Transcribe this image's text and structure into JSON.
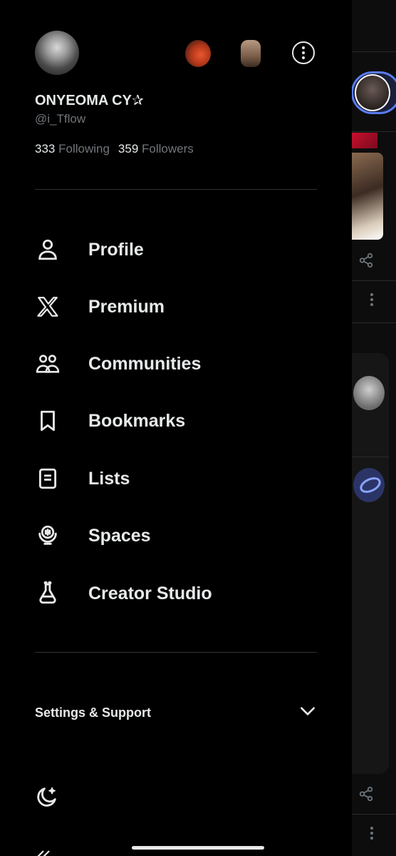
{
  "profile": {
    "name": "ONYEOMA CY✰",
    "handle": "@i_Tflow",
    "following_count": "333",
    "following_label": "Following",
    "followers_count": "359",
    "followers_label": "Followers"
  },
  "menu": {
    "items": [
      {
        "label": "Profile",
        "icon": "person-icon"
      },
      {
        "label": "Premium",
        "icon": "x-logo-icon"
      },
      {
        "label": "Communities",
        "icon": "communities-icon"
      },
      {
        "label": "Bookmarks",
        "icon": "bookmark-icon"
      },
      {
        "label": "Lists",
        "icon": "lists-icon"
      },
      {
        "label": "Spaces",
        "icon": "spaces-icon"
      },
      {
        "label": "Creator Studio",
        "icon": "flask-icon"
      }
    ]
  },
  "settings": {
    "label": "Settings & Support",
    "icon": "chevron-down-icon"
  },
  "footer": {
    "theme_icon": "moon-icon"
  },
  "colors": {
    "background": "#000000",
    "text_primary": "#e7e9ea",
    "text_secondary": "#71767b",
    "divider": "#2f3336"
  }
}
